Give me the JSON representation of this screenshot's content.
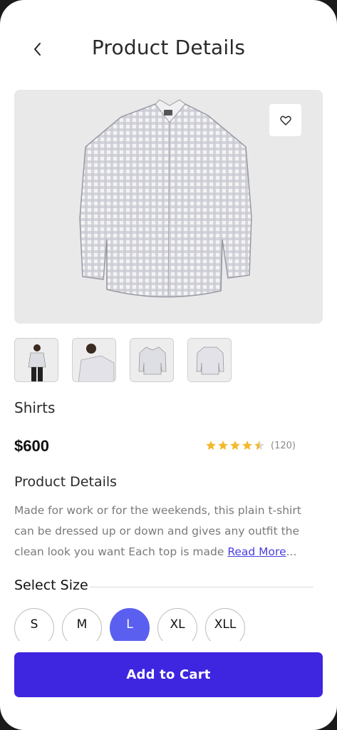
{
  "header": {
    "title": "Product Details",
    "back_icon": "chevron-left-icon"
  },
  "product": {
    "category": "Shirts",
    "price": "$600",
    "rating": 4.5,
    "reviews": "(120)",
    "favorite_icon": "heart-outline-icon",
    "thumbnails": [
      "model-front",
      "model-side",
      "shirt-front",
      "shirt-back"
    ]
  },
  "details": {
    "title": "Product Details",
    "text": "Made for work or for the weekends, this plain t-shirt can be dressed up or down and gives any outfit the clean look you want Each top is made ",
    "read_more": "Read More",
    "ellipsis": "..."
  },
  "sizes": {
    "title": "Select Size",
    "options": [
      "S",
      "M",
      "L",
      "XL",
      "XLL"
    ],
    "selected": "L"
  },
  "cart": {
    "label": "Add to Cart"
  },
  "colors": {
    "accent": "#3e25e0",
    "selected_size": "#5b5fef",
    "star": "#f4b82b",
    "link": "#4a3fe0"
  }
}
